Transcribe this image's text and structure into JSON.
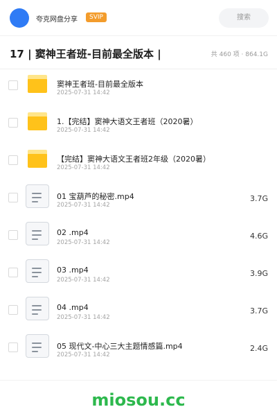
{
  "header": {
    "app_name": "夸克网盘分享",
    "vip_label": "SVIP",
    "search_label": "搜索"
  },
  "title": {
    "text": "17 | 窦神王者班-目前最全版本 |",
    "stats": "共 460 项 · 864.1G"
  },
  "items": [
    {
      "type": "folder",
      "name": "窦神王者班-目前最全版本",
      "date": "2025-07-31 14:42",
      "size": ""
    },
    {
      "type": "folder",
      "name": "1.【完结】窦神大语文王者班（2020暑）",
      "date": "2025-07-31 14:42",
      "size": ""
    },
    {
      "type": "folder",
      "name": "【完结】窦神大语文王者班2年级（2020暑）",
      "date": "2025-07-31 14:42",
      "size": ""
    },
    {
      "type": "file",
      "name": "01 宝葫芦的秘密.mp4",
      "date": "2025-07-31 14:42",
      "size": "3.7G"
    },
    {
      "type": "file",
      "name": "02 .mp4",
      "date": "2025-07-31 14:42",
      "size": "4.6G"
    },
    {
      "type": "file",
      "name": "03 .mp4",
      "date": "2025-07-31 14:42",
      "size": "3.9G"
    },
    {
      "type": "file",
      "name": "04 .mp4",
      "date": "2025-07-31 14:42",
      "size": "3.7G"
    },
    {
      "type": "file",
      "name": "05 现代文-中心三大主题情感篇.mp4",
      "date": "2025-07-31 14:42",
      "size": "2.4G"
    }
  ],
  "watermark": "miosou.cc",
  "colors": {
    "accent_blue": "#2f7bf5",
    "vip_orange": "#f39c2c",
    "folder_yellow": "#ffc21a",
    "watermark_green": "#2db84d"
  }
}
